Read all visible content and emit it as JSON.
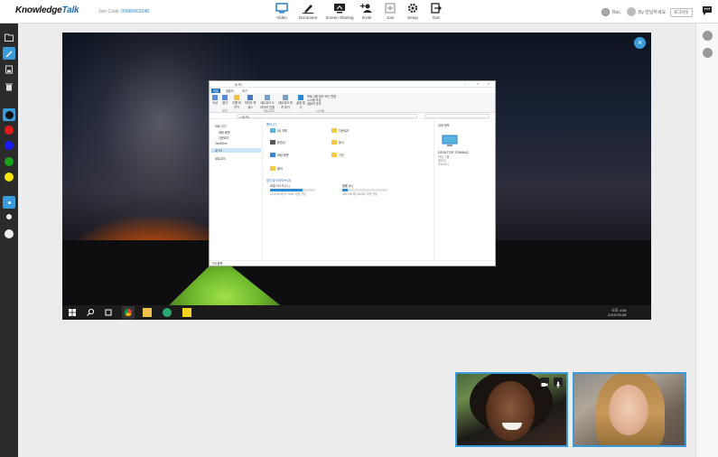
{
  "header": {
    "logo_part1": "Knowledge",
    "logo_part2": "Talk",
    "join_code_label": "Join Code:",
    "join_code_value": "05065661048",
    "toolbar": [
      {
        "label": "Video",
        "icon": "monitor-icon"
      },
      {
        "label": "Document",
        "icon": "pen-icon"
      },
      {
        "label": "Screen Sharing",
        "icon": "screen-share-icon"
      },
      {
        "label": "Invite",
        "icon": "add-user-icon"
      },
      {
        "label": "Join",
        "icon": "join-icon"
      },
      {
        "label": "Setup",
        "icon": "gear-icon"
      },
      {
        "label": "Exit",
        "icon": "exit-icon"
      }
    ],
    "rec_label": "Rec.",
    "user_name": "By 만남하세요",
    "logout_label": "로그아웃"
  },
  "colors": {
    "accent": "#3b9ad9",
    "toolbar_bg": "#2b2b2b",
    "pen_colors": [
      "#111111",
      "#e41b1b",
      "#1a1aff",
      "#1aa11a",
      "#f5e311"
    ]
  },
  "explorer": {
    "title": "내 PC",
    "tabs": [
      "파일",
      "컴퓨터",
      "보기"
    ],
    "ribbon_groups": [
      "위치",
      "네트워크",
      "시스템"
    ],
    "ribbon_items": [
      "속성",
      "열기",
      "이름 바꾸기",
      "미디어 액세스",
      "네트워크 드라이브 연결",
      "네트워크 위치 추가",
      "설정 열기",
      "프로그램 제거 또는 변경",
      "시스템 속성",
      "컴퓨터 관리"
    ],
    "address": "> 내 PC",
    "nav_items": [
      "바로 가기",
      "바탕 화면",
      "다운로드",
      "OneDrive",
      "내 PC",
      "네트워크"
    ],
    "folders_header": "폴더 (7)",
    "folders": [
      "3D 개체",
      "다운로드",
      "동영상",
      "문서",
      "바탕 화면",
      "사진",
      "음악"
    ],
    "drives_header": "장치 및 드라이브 (2)",
    "drives": [
      {
        "name": "로컬 디스크 (C:)",
        "free": "23.0GB 중 87.5GB 사용 가능",
        "used": 0.72
      },
      {
        "name": "볼륨 (D:)",
        "free": "390 GB 중 236GB 사용 가능",
        "used": 0.12
      }
    ],
    "details_title": "상세 정보",
    "pc_name": "DESKTOP-7D9584Q",
    "pc_info": [
      "작업 그룹",
      "메모리",
      "프로세서"
    ],
    "status": "9개 항목"
  },
  "taskbar": {
    "time": "오후 4:06",
    "date": "2019-05-08"
  }
}
